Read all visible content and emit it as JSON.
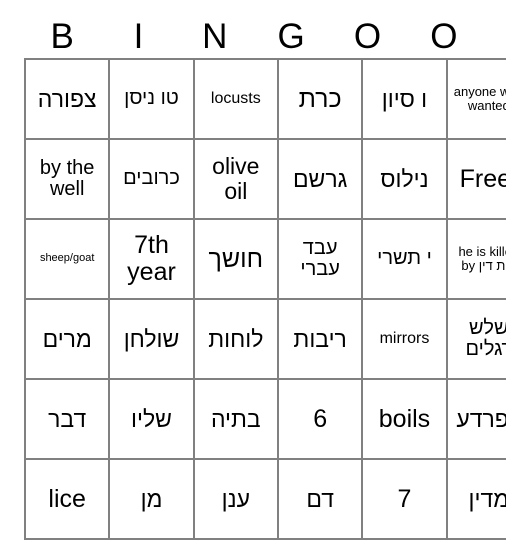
{
  "card": {
    "title": "BINGO",
    "header": {
      "letters": [
        "B",
        "I",
        "N",
        "G",
        "O",
        "O"
      ]
    },
    "colors": {
      "border": "#808080",
      "text": "#000000",
      "background": "#ffffff"
    },
    "grid": {
      "columns": 6,
      "rows": 6,
      "cells": [
        [
          {
            "text": "צפורה",
            "lang": "he",
            "size": "lg"
          },
          {
            "text": "טו ניסן",
            "lang": "he",
            "size": "md"
          },
          {
            "text": "locusts",
            "lang": "en",
            "size": "sm"
          },
          {
            "text": "כרת",
            "lang": "he",
            "size": "xl"
          },
          {
            "text": "ו סיון",
            "lang": "he",
            "size": "lg"
          },
          {
            "text": "anyone who wanted",
            "lang": "en",
            "size": "xs"
          }
        ],
        [
          {
            "text": "by the well",
            "lang": "en",
            "size": "md"
          },
          {
            "text": "כרובים",
            "lang": "he",
            "size": "md"
          },
          {
            "text": "olive oil",
            "lang": "en",
            "size": "lg"
          },
          {
            "text": "גרשם",
            "lang": "he",
            "size": "lg"
          },
          {
            "text": "נילוס",
            "lang": "he",
            "size": "lg"
          },
          {
            "text": "Free!",
            "lang": "en",
            "size": "xl"
          }
        ],
        [
          {
            "text": "sheep/goat",
            "lang": "en",
            "size": "xxs"
          },
          {
            "text": "7th year",
            "lang": "en",
            "size": "xl"
          },
          {
            "text": "חושך",
            "lang": "he",
            "size": "xl"
          },
          {
            "text": "עבד עברי",
            "lang": "he",
            "size": "md"
          },
          {
            "text": "י תשרי",
            "lang": "he",
            "size": "md"
          },
          {
            "text": "he is killed by בית דין",
            "lang": "mixed",
            "size": "xs"
          }
        ],
        [
          {
            "text": "מרים",
            "lang": "he",
            "size": "lg"
          },
          {
            "text": "שולחן",
            "lang": "he",
            "size": "lg"
          },
          {
            "text": "לוחות",
            "lang": "he",
            "size": "lg"
          },
          {
            "text": "ריבות",
            "lang": "he",
            "size": "lg"
          },
          {
            "text": "mirrors",
            "lang": "en",
            "size": "sm"
          },
          {
            "text": "שלש רגלים",
            "lang": "he",
            "size": "md"
          }
        ],
        [
          {
            "text": "דבר",
            "lang": "he",
            "size": "lg"
          },
          {
            "text": "שליו",
            "lang": "he",
            "size": "lg"
          },
          {
            "text": "בתיה",
            "lang": "he",
            "size": "lg"
          },
          {
            "text": "6",
            "lang": "en",
            "size": "xl"
          },
          {
            "text": "boils",
            "lang": "en",
            "size": "xl"
          },
          {
            "text": "צפרדע",
            "lang": "he",
            "size": "lg"
          }
        ],
        [
          {
            "text": "lice",
            "lang": "en",
            "size": "xl"
          },
          {
            "text": "מן",
            "lang": "he",
            "size": "lg"
          },
          {
            "text": "ענן",
            "lang": "he",
            "size": "lg"
          },
          {
            "text": "דם",
            "lang": "he",
            "size": "lg"
          },
          {
            "text": "7",
            "lang": "en",
            "size": "xl"
          },
          {
            "text": "מדין",
            "lang": "he",
            "size": "lg"
          }
        ]
      ]
    }
  }
}
